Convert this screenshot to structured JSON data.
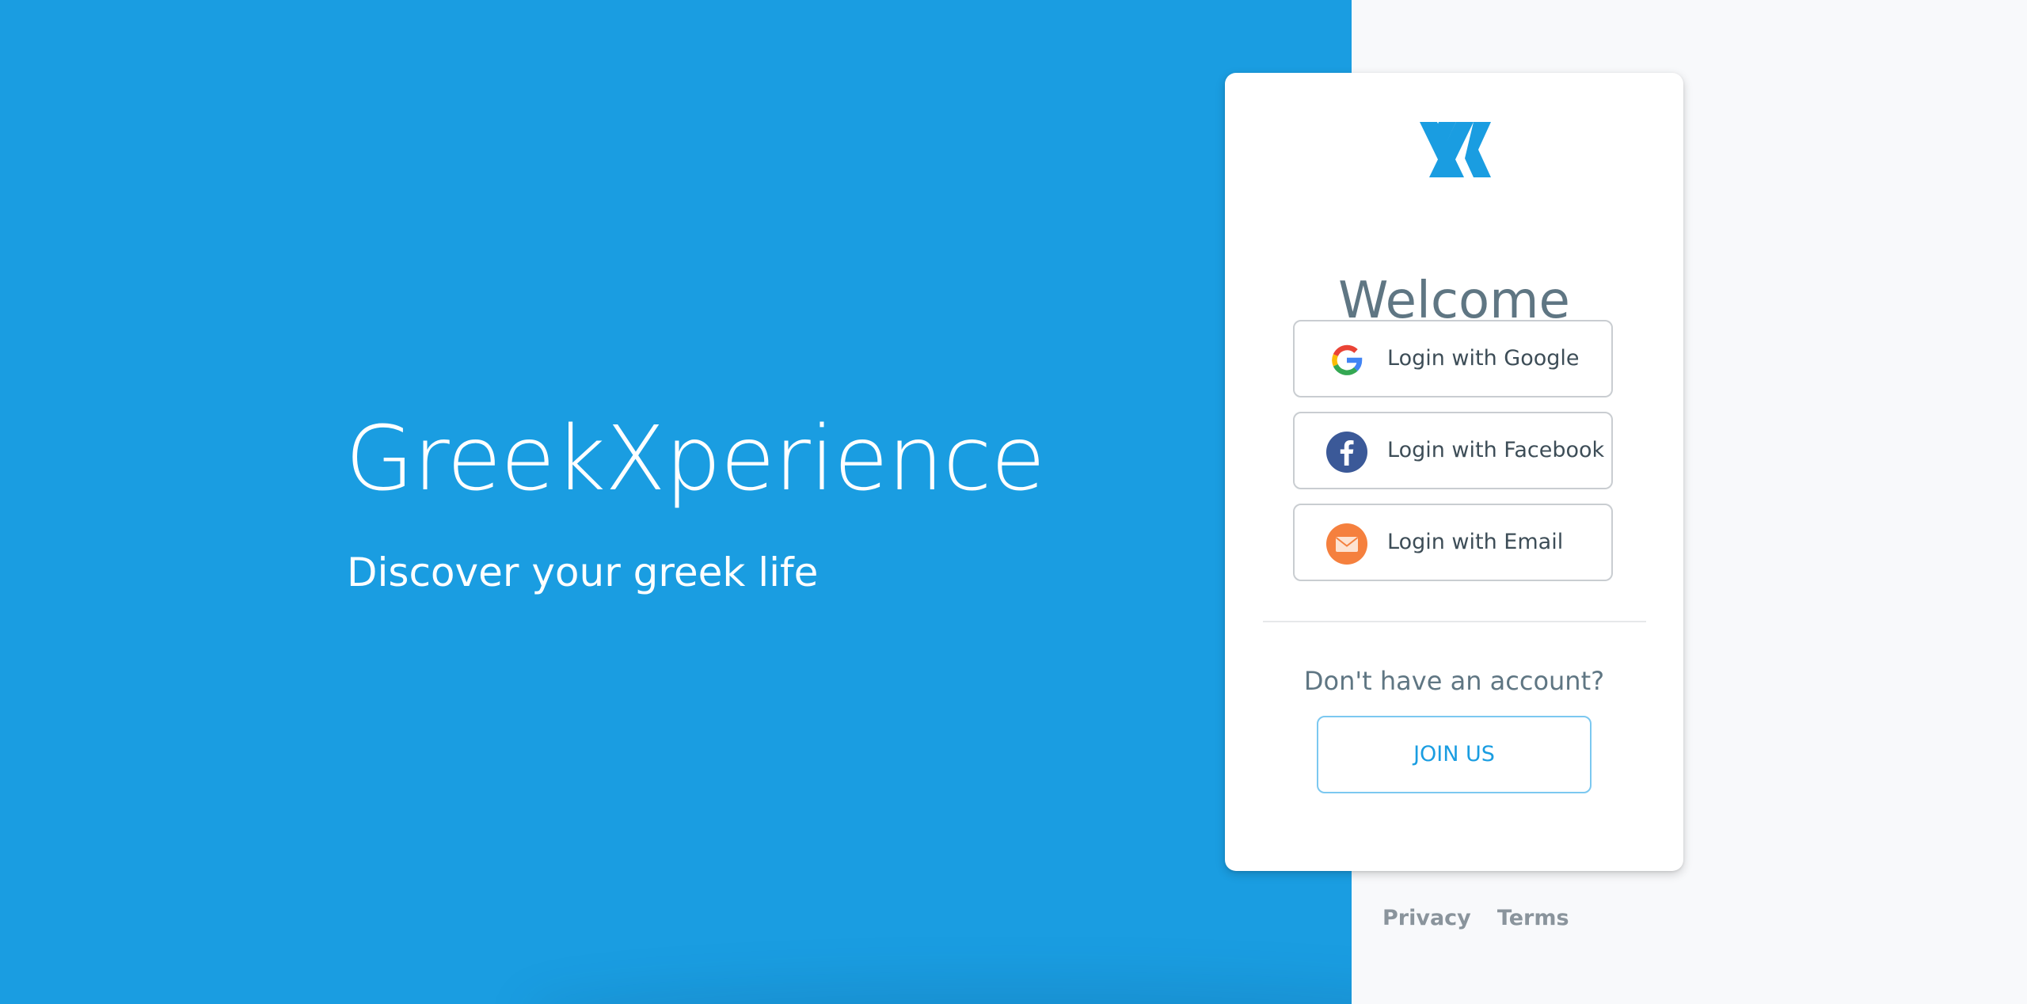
{
  "hero": {
    "title": "GreekXperience",
    "tagline": "Discover your greek life",
    "background_color": "#1a9de1"
  },
  "card": {
    "logo_icon": "greekxperience-x-logo-icon",
    "welcome": "Welcome",
    "buttons": [
      {
        "label": "Login with Google",
        "icon": "google-icon"
      },
      {
        "label": "Login with Facebook",
        "icon": "facebook-icon"
      },
      {
        "label": "Login with Email",
        "icon": "email-envelope-icon"
      }
    ],
    "signup_prompt": "Don't have an account?",
    "join_label": "JOIN US"
  },
  "footer": {
    "links": [
      {
        "label": "Privacy"
      },
      {
        "label": "Terms"
      }
    ]
  },
  "colors": {
    "accent": "#1a9de1",
    "text_muted": "#5f7683",
    "facebook": "#3b5998",
    "email": "#f5803e",
    "side_background": "#f8f9fb"
  }
}
